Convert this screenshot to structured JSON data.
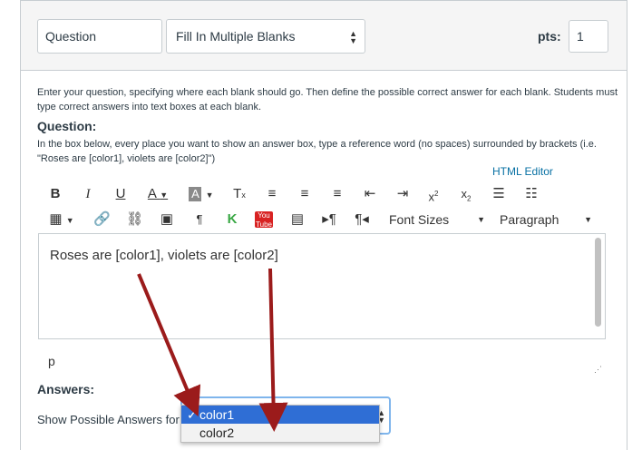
{
  "header": {
    "question_name": "Question",
    "question_type": "Fill In Multiple Blanks",
    "pts_label": "pts:",
    "pts_value": "1"
  },
  "instructions": "Enter your question, specifying where each blank should go. Then define the possible correct answer for each blank. Students must type correct answers into text boxes at each blank.",
  "question_section": {
    "label": "Question:",
    "help": "In the box below, every place you want to show an answer box, type a reference word (no spaces) surrounded by brackets (i.e. \"Roses are [color1], violets are [color2]\")",
    "html_editor_link": "HTML Editor"
  },
  "toolbar": {
    "font_sizes_label": "Font Sizes",
    "paragraph_label": "Paragraph"
  },
  "editor": {
    "content": "Roses are [color1], violets are [color2]",
    "path": "p"
  },
  "answers": {
    "label": "Answers:",
    "show_label": "Show Possible Answers for",
    "options": [
      "color1",
      "color2"
    ],
    "selected": "color1"
  },
  "colors": {
    "arrow": "#9b1b1b",
    "link": "#0770a3",
    "selection": "#2f6ed5"
  }
}
